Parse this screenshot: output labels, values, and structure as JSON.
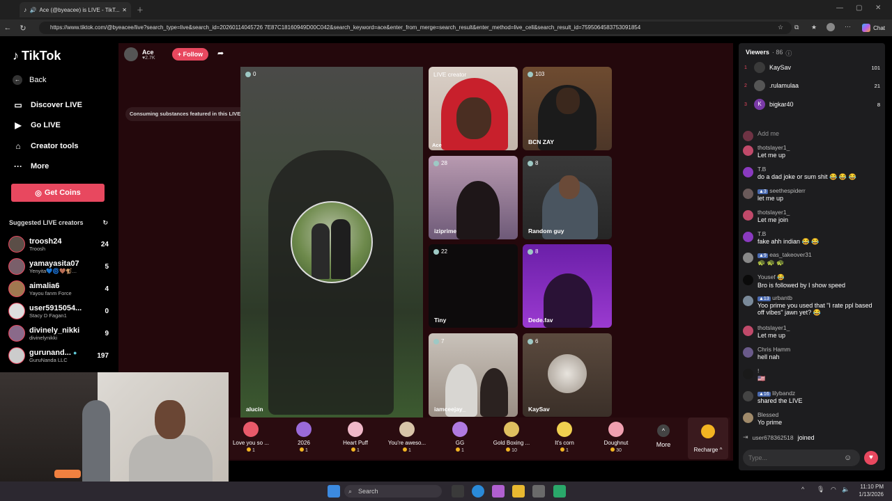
{
  "browser": {
    "tab_title": "Ace (@byeacee) is LIVE - TikT...",
    "url": "https://www.tiktok.com/@byeacee/live?search_type=live&search_id=20260114045726 7E87C18160949D00C042&search_keyword=ace&enter_from_merge=search_result&enter_method=live_cell&search_result_id=7595064583753091854",
    "chat_label": "Chat"
  },
  "sidebar": {
    "logo": "TikTok",
    "back": "Back",
    "discover": "Discover LIVE",
    "golive": "Go LIVE",
    "creator_tools": "Creator tools",
    "more": "More",
    "get_coins": "Get Coins",
    "suggested_header": "Suggested LIVE creators",
    "creators": [
      {
        "name": "troosh24",
        "sub": "Troosh",
        "count": "24"
      },
      {
        "name": "yamayasita07",
        "sub": "Yenyita💙🌀🤎🐒...",
        "count": "5"
      },
      {
        "name": "aimalia6",
        "sub": "Yayou fanm Force",
        "count": "4"
      },
      {
        "name": "user5915054...",
        "sub": "Stacy D Fagan1",
        "count": "0"
      },
      {
        "name": "divinely_nikki",
        "sub": "divinelynikki",
        "count": "9"
      },
      {
        "name": "gurunand...",
        "sub": "GuruNanda LLC",
        "count": "197"
      }
    ]
  },
  "stream": {
    "host_name": "Ace",
    "host_likes": "♥2.7K",
    "follow": "+ Follow",
    "notice": "Consuming substances featured in this LIVE could ha...",
    "main_count": "0",
    "main_name": "alucin",
    "guests": [
      {
        "label": "LIVE creator",
        "name": "Ace",
        "count": ""
      },
      {
        "label": "",
        "name": "BCN ZAY",
        "count": "103"
      },
      {
        "label": "",
        "name": "iziprime",
        "count": "28"
      },
      {
        "label": "",
        "name": "Random guy",
        "count": "8"
      },
      {
        "label": "",
        "name": "Tiny",
        "count": "22"
      },
      {
        "label": "",
        "name": "Dede.fav",
        "count": "8"
      },
      {
        "label": "",
        "name": "iamceejay_",
        "count": "7"
      },
      {
        "label": "",
        "name": "KaySav",
        "count": "6"
      }
    ]
  },
  "gifts": [
    {
      "name": "Love you so ...",
      "price": "1"
    },
    {
      "name": "2026",
      "price": "1"
    },
    {
      "name": "Heart Puff",
      "price": "1"
    },
    {
      "name": "You're aweso...",
      "price": "1"
    },
    {
      "name": "GG",
      "price": "1"
    },
    {
      "name": "Gold Boxing ...",
      "price": "10"
    },
    {
      "name": "It's corn",
      "price": "1"
    },
    {
      "name": "Doughnut",
      "price": "30"
    }
  ],
  "gift_more": "More",
  "recharge": "Recharge ^",
  "viewers": {
    "header": "Viewers",
    "count": "· 86",
    "top": [
      {
        "rank": "1",
        "name": "KaySav",
        "value": "101"
      },
      {
        "rank": "2",
        "name": ".rulamulaa",
        "value": "21"
      },
      {
        "rank": "3",
        "name": "bigkar40",
        "value": "8"
      }
    ]
  },
  "chat": [
    {
      "user": "",
      "text": "Add me"
    },
    {
      "user": "thotslayer1_",
      "text": "Let me up"
    },
    {
      "user": "T.B",
      "text": "do a dad joke or sum shit 😂 😂 😂"
    },
    {
      "user": "seethespiderr",
      "text": "let me up"
    },
    {
      "user": "thotslayer1_",
      "text": "Let me join"
    },
    {
      "user": "T.B",
      "text": "fake ahh indian 😂 😂"
    },
    {
      "user": "eas_takeover31",
      "text": "🐢 🐢 🐢"
    },
    {
      "user": "Yousef 😂",
      "text": "Bro is followed by I show speed"
    },
    {
      "user": "urbantb",
      "text": "Yoo prime you used that \"I rate ppl based off vibes\" jawn yet? 😂"
    },
    {
      "user": "thotslayer1_",
      "text": "Let me up"
    },
    {
      "user": "Chris Hamm",
      "text": "hell nah"
    },
    {
      "user": "!",
      "text": "🇺🇸"
    },
    {
      "user": "lilybandz",
      "text": "shared the LIVE"
    },
    {
      "user": "Blessed",
      "text": "Yo prime"
    },
    {
      "user": "user678362518",
      "text": "joined"
    }
  ],
  "chat_placeholder": "Type...",
  "taskbar": {
    "search": "Search",
    "time": "11:10 PM",
    "date": "1/13/2026"
  }
}
